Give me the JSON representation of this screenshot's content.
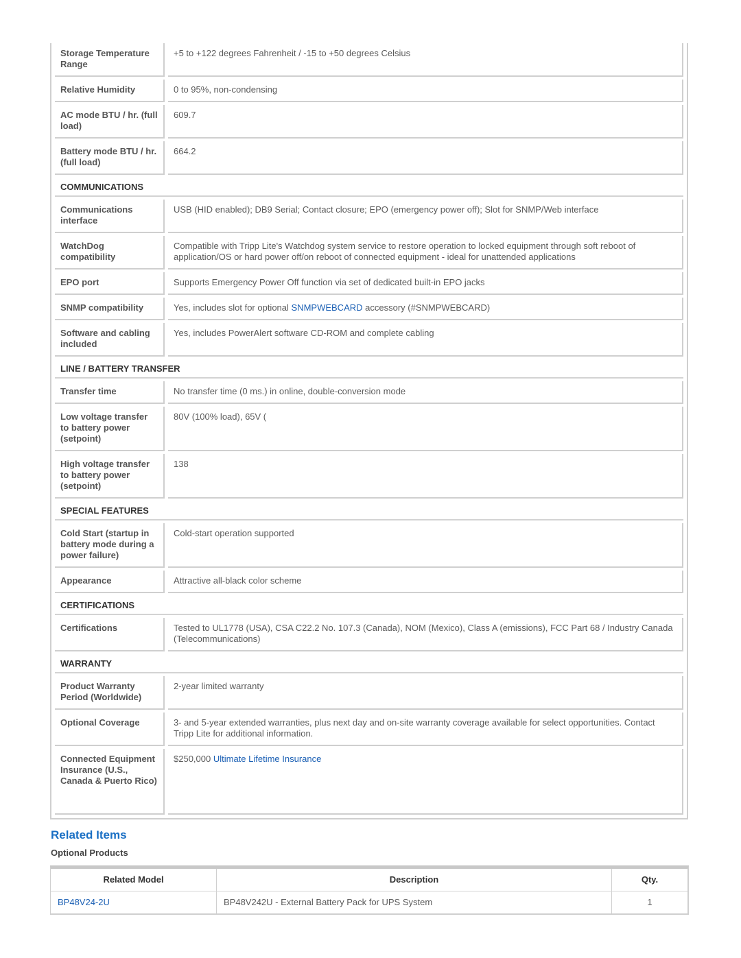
{
  "specs": {
    "rows_top": [
      {
        "label": "Storage Temperature Range",
        "value": "+5 to +122 degrees Fahrenheit / -15 to +50 degrees Celsius"
      },
      {
        "label": "Relative Humidity",
        "value": "0 to 95%, non-condensing"
      },
      {
        "label": "AC mode BTU / hr. (full load)",
        "value": "609.7"
      },
      {
        "label": "Battery mode BTU / hr. (full load)",
        "value": "664.2"
      }
    ],
    "communications": {
      "title": "COMMUNICATIONS",
      "rows": [
        {
          "label": "Communications interface",
          "value": "USB (HID enabled); DB9 Serial; Contact closure; EPO (emergency power off); Slot for SNMP/Web interface"
        },
        {
          "label": "WatchDog compatibility",
          "value": "Compatible with Tripp Lite's Watchdog system service to restore operation to locked equipment through soft reboot of application/OS or hard power off/on reboot of connected equipment - ideal for unattended applications"
        },
        {
          "label": "EPO port",
          "value": "Supports Emergency Power Off function via set of dedicated built-in EPO jacks"
        },
        {
          "label": "SNMP compatibility",
          "value_prefix": "Yes, includes slot for optional ",
          "value_link": "SNMPWEBCARD",
          "value_suffix": " accessory (#SNMPWEBCARD)"
        },
        {
          "label": "Software and cabling included",
          "value": "Yes, includes PowerAlert software CD-ROM and complete cabling"
        }
      ]
    },
    "line_battery_transfer": {
      "title": "LINE / BATTERY TRANSFER",
      "rows": [
        {
          "label": "Transfer time",
          "value": "No transfer time (0 ms.) in online, double-conversion mode"
        },
        {
          "label": "Low voltage transfer to battery power (setpoint)",
          "value": "80V (100% load), 65V ("
        },
        {
          "label": "High voltage transfer to battery power (setpoint)",
          "value": "138"
        }
      ]
    },
    "special_features": {
      "title": "SPECIAL FEATURES",
      "rows": [
        {
          "label": "Cold Start (startup in battery mode during a power failure)",
          "value": "Cold-start operation supported"
        },
        {
          "label": "Appearance",
          "value": "Attractive all-black color scheme"
        }
      ]
    },
    "certifications": {
      "title": "CERTIFICATIONS",
      "rows": [
        {
          "label": "Certifications",
          "value": "Tested to UL1778 (USA), CSA C22.2 No. 107.3 (Canada), NOM (Mexico), Class A (emissions), FCC Part 68 / Industry Canada (Telecommunications)"
        }
      ]
    },
    "warranty": {
      "title": "WARRANTY",
      "rows": [
        {
          "label": "Product Warranty Period (Worldwide)",
          "value": "2-year limited warranty"
        },
        {
          "label": "Optional Coverage",
          "value": "3- and 5-year extended warranties, plus next day and on-site warranty coverage available for select opportunities. Contact Tripp Lite for additional information."
        },
        {
          "label": "Connected Equipment Insurance (U.S., Canada & Puerto Rico)",
          "value_prefix": "$250,000 ",
          "value_link": "Ultimate Lifetime Insurance"
        }
      ]
    }
  },
  "related": {
    "title": "Related Items",
    "subtitle": "Optional Products",
    "columns": [
      "Related Model",
      "Description",
      "Qty."
    ],
    "rows": [
      {
        "model": "BP48V24-2U",
        "description": "BP48V242U - External Battery Pack for UPS System",
        "qty": "1"
      }
    ]
  },
  "colors": {
    "link": "#1a5fb4",
    "heading_accent": "#1a6fc4",
    "label_text": "#555555",
    "border": "#cfcfcf"
  }
}
